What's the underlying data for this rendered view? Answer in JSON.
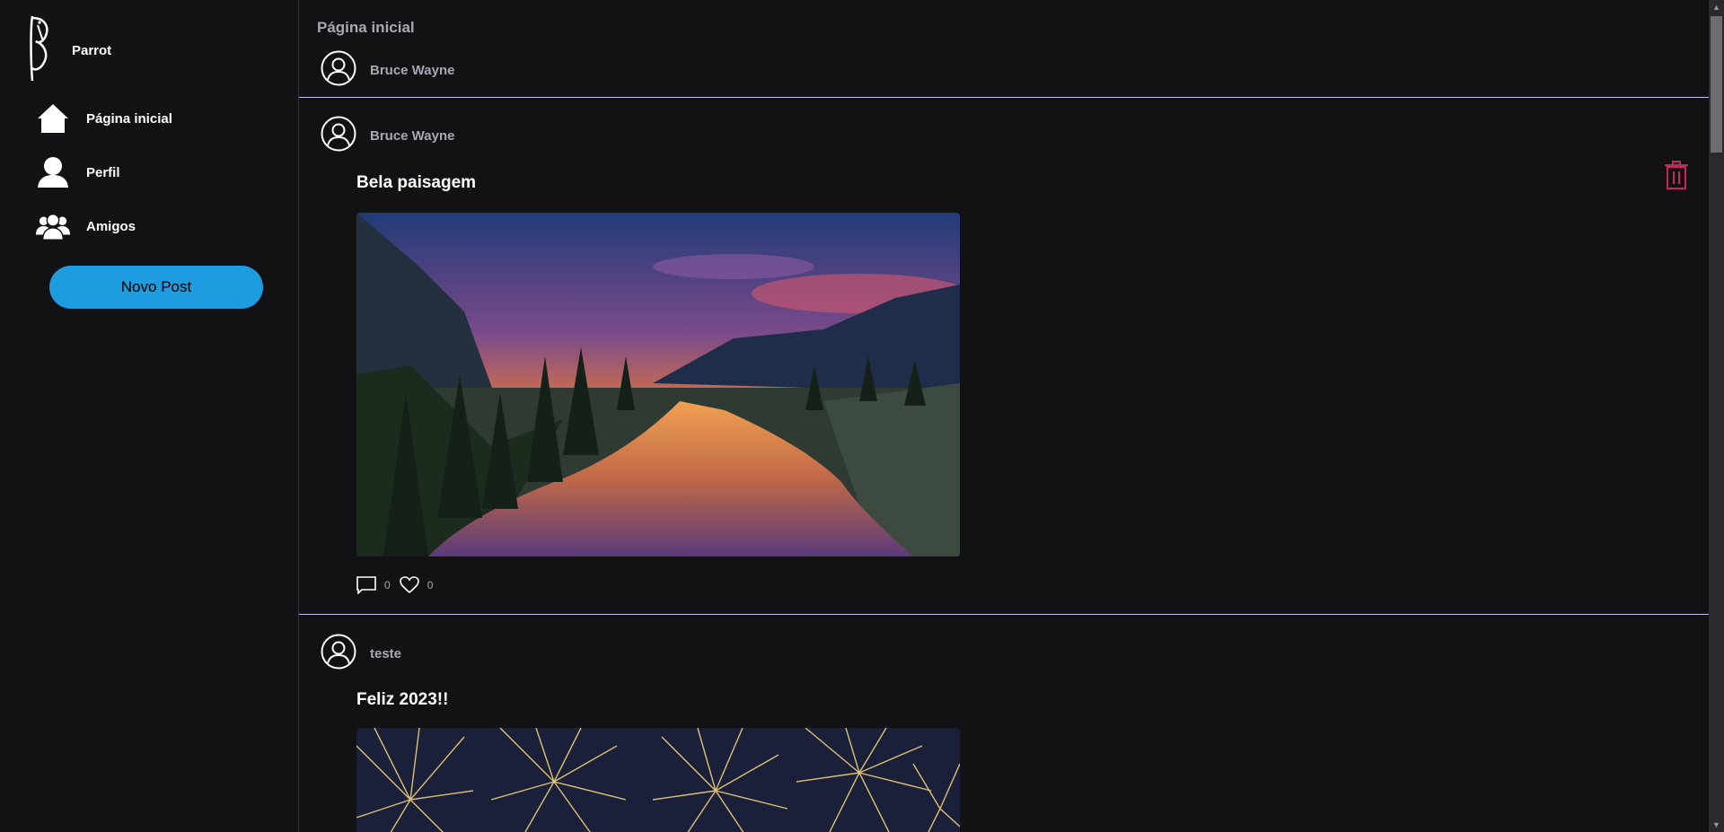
{
  "app": {
    "name": "Parrot"
  },
  "sidebar": {
    "items": [
      {
        "label": "Página inicial",
        "icon": "home-icon"
      },
      {
        "label": "Perfil",
        "icon": "user-icon"
      },
      {
        "label": "Amigos",
        "icon": "users-icon"
      }
    ],
    "new_post_label": "Novo Post"
  },
  "main": {
    "title": "Página inicial",
    "composer_user": "Bruce Wayne"
  },
  "posts": [
    {
      "author": "Bruce Wayne",
      "title": "Bela paisagem",
      "comments": "0",
      "likes": "0",
      "image": "sunset-river-landscape"
    },
    {
      "author": "teste",
      "title": "Feliz 2023!!",
      "image": "fireworks"
    }
  ],
  "colors": {
    "accent": "#1d9ce0",
    "delete": "#c4285a",
    "background": "#121214",
    "muted": "#a8a8b3"
  }
}
